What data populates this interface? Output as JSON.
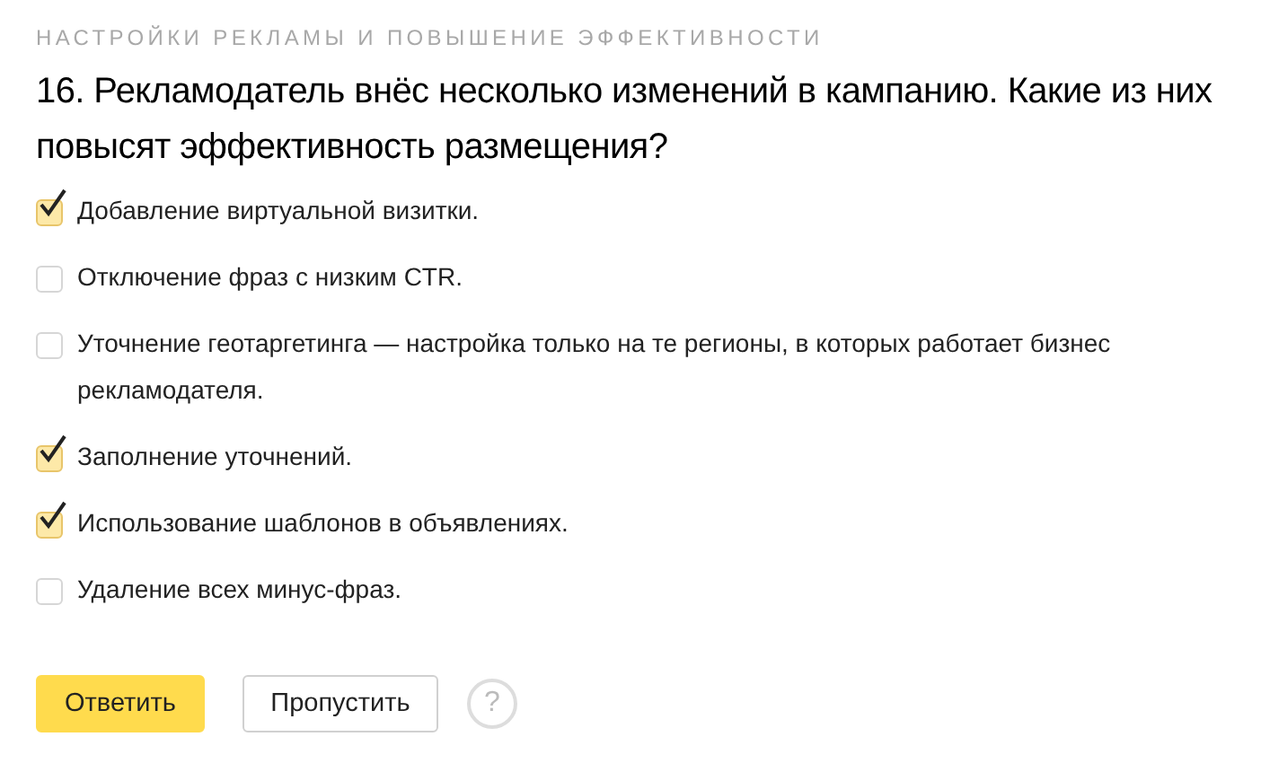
{
  "section_title": "НАСТРОЙКИ РЕКЛАМЫ И ПОВЫШЕНИЕ ЭФФЕКТИВНОСТИ",
  "question": "16. Рекламодатель внёс несколько изменений в кампанию. Какие из них повысят эффективность размещения?",
  "options": [
    {
      "label": "Добавление виртуальной визитки.",
      "checked": true
    },
    {
      "label": "Отключение фраз с низким CTR.",
      "checked": false
    },
    {
      "label": "Уточнение геотаргетинга — настройка только на те регионы, в которых работает бизнес рекламодателя.",
      "checked": false
    },
    {
      "label": "Заполнение уточнений.",
      "checked": true
    },
    {
      "label": "Использование шаблонов в объявлениях.",
      "checked": true
    },
    {
      "label": "Удаление всех минус-фраз.",
      "checked": false
    }
  ],
  "buttons": [
    {
      "label": "Ответить",
      "kind": "primary"
    },
    {
      "label": "Пропустить",
      "kind": "secondary"
    }
  ],
  "help": "?"
}
